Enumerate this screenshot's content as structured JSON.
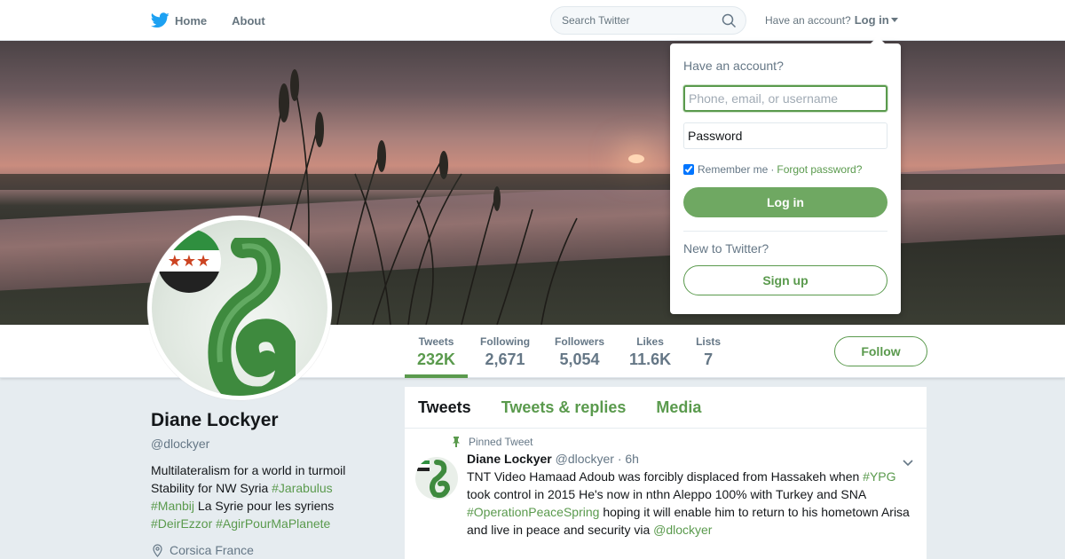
{
  "nav": {
    "home_label": "Home",
    "about_label": "About",
    "search_placeholder": "Search Twitter",
    "have_account_text": "Have an account?",
    "login_label": "Log in"
  },
  "icons": {
    "brand": "twitter-bird-icon",
    "search": "search-icon",
    "caret": "caret-down-icon",
    "pin": "pin-icon",
    "location": "location-pin-icon",
    "tweet_menu": "chevron-down-icon"
  },
  "colors": {
    "accent": "#5a9a4d",
    "login_button": "#6fa862",
    "brand_blue": "#1da1f2"
  },
  "profile": {
    "name": "Diane Lockyer",
    "handle": "@dlockyer",
    "bio_lines": [
      {
        "text": "Multilateralism for a world in turmoil",
        "tags": ""
      },
      {
        "text": "Stability for NW Syria ",
        "tags": "#Jarabulus"
      },
      {
        "tags_pre": "#Manbij",
        "text": " La Syrie pour les syriens"
      },
      {
        "tags": "#DeirEzzor #AgirPourMaPlanete"
      }
    ],
    "location": "Corsica France"
  },
  "stats": [
    {
      "label": "Tweets",
      "value": "232K"
    },
    {
      "label": "Following",
      "value": "2,671"
    },
    {
      "label": "Followers",
      "value": "5,054"
    },
    {
      "label": "Likes",
      "value": "11.6K"
    },
    {
      "label": "Lists",
      "value": "7"
    }
  ],
  "follow_label": "Follow",
  "timeline": {
    "tabs": [
      "Tweets",
      "Tweets & replies",
      "Media"
    ],
    "pinned_label": "Pinned Tweet",
    "tweet": {
      "name": "Diane Lockyer",
      "handle": "@dlockyer",
      "time": "· 6h",
      "parts": [
        "TNT Video Hamaad Adoub was forcibly displaced from Hassakeh when ",
        "#YPG",
        " took control in 2015 He's now in nthn Aleppo 100% with Turkey and SNA ",
        "#OperationPeaceSpring",
        " hoping it will enable him to return to his hometown Arisa and live in peace and security via ",
        "@dlockyer"
      ]
    }
  },
  "login_dropdown": {
    "title": "Have an account?",
    "username_placeholder": "Phone, email, or username",
    "password_placeholder": "Password",
    "remember_label": "Remember me",
    "separator": "·",
    "forgot_label": "Forgot password?",
    "login_button": "Log in",
    "new_text": "New to Twitter?",
    "signup_button": "Sign up"
  }
}
